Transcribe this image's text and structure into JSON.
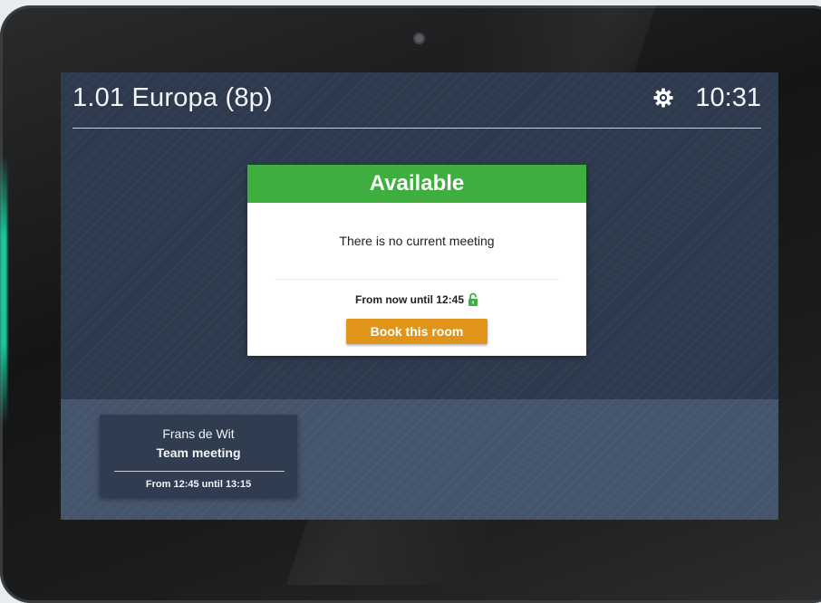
{
  "header": {
    "room_name": "1.01 Europa (8p)",
    "time": "10:31",
    "settings_icon": "gear-icon"
  },
  "status": {
    "label": "Available",
    "color": "#3eae3e",
    "message": "There is no current meeting",
    "range": "From now until 12:45",
    "range_icon": "lock-icon",
    "book_button": "Book this room",
    "book_button_color": "#e0941a"
  },
  "upcoming": [
    {
      "organizer": "Frans de Wit",
      "title": "Team meeting",
      "time": "From 12:45 until 13:15"
    }
  ],
  "colors": {
    "screen_bg": "#2d3a4d",
    "strip_bg": "#44546b",
    "led": "#19c79a"
  }
}
